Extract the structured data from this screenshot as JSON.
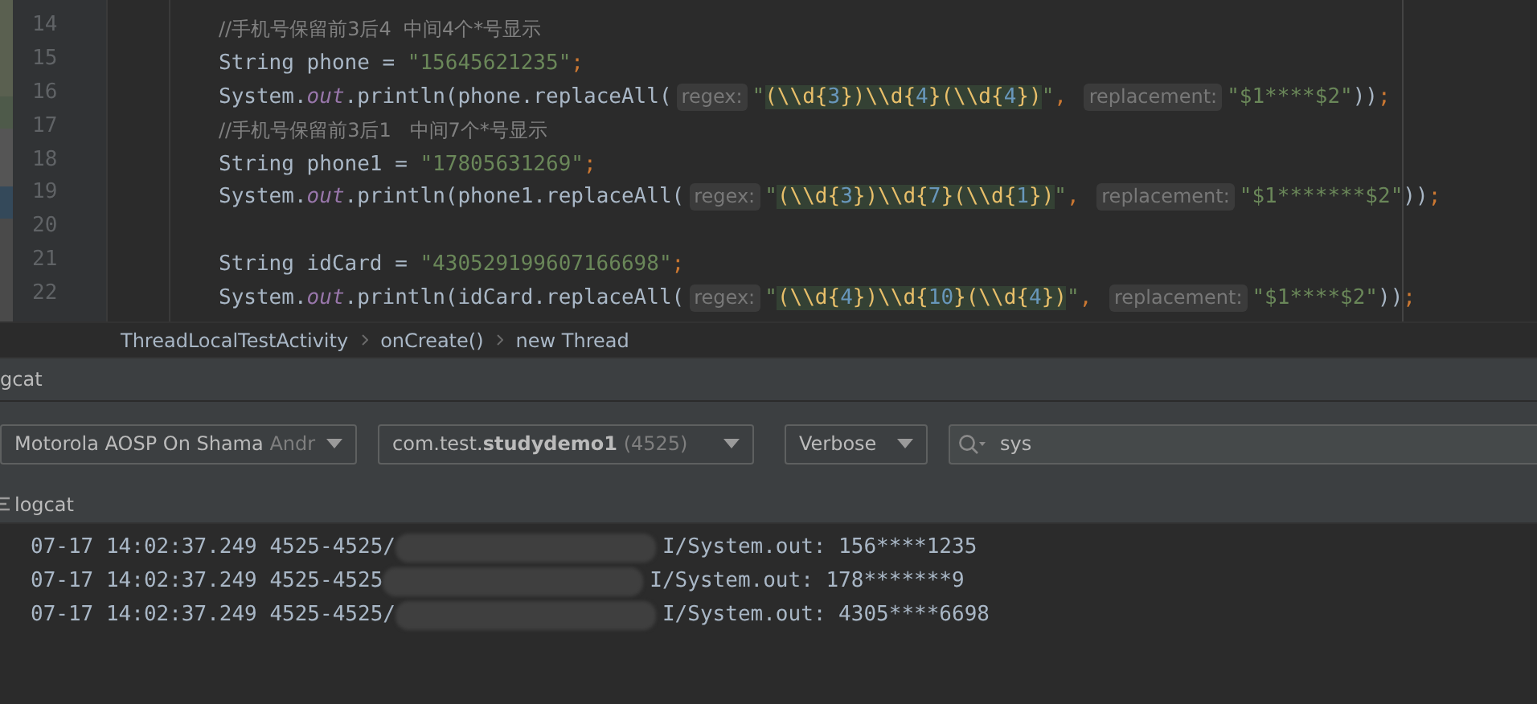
{
  "editor": {
    "lines": [
      {
        "number": "14",
        "tokens": [
          {
            "kind": "comment",
            "text": "//手机号保留前3后4  中间4个*号显示"
          }
        ]
      },
      {
        "number": "15",
        "tokens": [
          {
            "kind": "plain",
            "text": "String phone = "
          },
          {
            "kind": "string",
            "text": "\"15645621235\""
          },
          {
            "kind": "punct",
            "text": ";"
          }
        ]
      },
      {
        "number": "16",
        "tokens": [
          {
            "kind": "plain",
            "text": "System."
          },
          {
            "kind": "field",
            "text": "out"
          },
          {
            "kind": "plain",
            "text": ".println(phone.replaceAll("
          },
          {
            "kind": "hint",
            "text": "regex:"
          },
          {
            "kind": "string",
            "text": "\""
          },
          {
            "kind": "regex",
            "text": "(\\\\d{3})\\\\d{4}(\\\\d{4})"
          },
          {
            "kind": "string",
            "text": "\""
          },
          {
            "kind": "punct",
            "text": ", "
          },
          {
            "kind": "hint",
            "text": "replacement:"
          },
          {
            "kind": "string",
            "text": "\"$1****$2\""
          },
          {
            "kind": "plain",
            "text": "))"
          },
          {
            "kind": "punct",
            "text": ";"
          }
        ]
      },
      {
        "number": "17",
        "tokens": [
          {
            "kind": "comment",
            "text": "//手机号保留前3后1   中间7个*号显示"
          }
        ]
      },
      {
        "number": "18",
        "tokens": [
          {
            "kind": "plain",
            "text": "String phone1 = "
          },
          {
            "kind": "string",
            "text": "\"17805631269\""
          },
          {
            "kind": "punct",
            "text": ";"
          }
        ]
      },
      {
        "number": "19",
        "tokens": [
          {
            "kind": "plain",
            "text": "System."
          },
          {
            "kind": "field",
            "text": "out"
          },
          {
            "kind": "plain",
            "text": ".println(phone1.replaceAll("
          },
          {
            "kind": "hint",
            "text": "regex:"
          },
          {
            "kind": "string",
            "text": "\""
          },
          {
            "kind": "regex",
            "text": "(\\\\d{3})\\\\d{7}(\\\\d{1})"
          },
          {
            "kind": "string",
            "text": "\""
          },
          {
            "kind": "punct",
            "text": ", "
          },
          {
            "kind": "hint",
            "text": "replacement:"
          },
          {
            "kind": "string",
            "text": "\"$1*******$2\""
          },
          {
            "kind": "plain",
            "text": "))"
          },
          {
            "kind": "punct",
            "text": ";"
          }
        ]
      },
      {
        "number": "20"
      },
      {
        "number": "21",
        "tokens": [
          {
            "kind": "plain",
            "text": "String idCard = "
          },
          {
            "kind": "string",
            "text": "\"430529199607166698\""
          },
          {
            "kind": "punct",
            "text": ";"
          }
        ]
      },
      {
        "number": "22",
        "tokens": [
          {
            "kind": "plain",
            "text": "System."
          },
          {
            "kind": "field",
            "text": "out"
          },
          {
            "kind": "plain",
            "text": ".println(idCard.replaceAll("
          },
          {
            "kind": "hint",
            "text": "regex:"
          },
          {
            "kind": "string",
            "text": "\""
          },
          {
            "kind": "regex",
            "text": "(\\\\d{4})\\\\d{10}(\\\\d{4})"
          },
          {
            "kind": "string",
            "text": "\""
          },
          {
            "kind": "punct",
            "text": ", "
          },
          {
            "kind": "hint",
            "text": "replacement:"
          },
          {
            "kind": "string",
            "text": "\"$1****$2\""
          },
          {
            "kind": "plain",
            "text": "))"
          },
          {
            "kind": "punct",
            "text": ";"
          }
        ]
      }
    ]
  },
  "breadcrumbs": [
    "ThreadLocalTestActivity",
    "onCreate()",
    "new Thread"
  ],
  "panel": {
    "title": "gcat"
  },
  "toolbar": {
    "device": {
      "name": "Motorola AOSP On Shama",
      "suffix": "Andr"
    },
    "process": {
      "package": "com.test.",
      "app": "studydemo1",
      "pid": "(4525)"
    },
    "level": "Verbose",
    "search": {
      "value": "sys"
    }
  },
  "tab": {
    "label": "logcat"
  },
  "log": [
    {
      "prefix": "07-17 14:02:37.249 4525-4525/",
      "message": "I/System.out: 156****1235"
    },
    {
      "prefix": "07-17 14:02:37.249 4525-4525",
      "message": "I/System.out: 178*******9"
    },
    {
      "prefix": "07-17 14:02:37.249 4525-4525/",
      "message": "I/System.out: 4305****6698"
    }
  ]
}
